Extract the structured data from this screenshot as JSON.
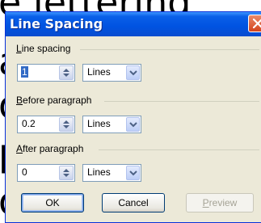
{
  "background_document": {
    "lines": [
      "e lettering",
      "a",
      "o",
      "p",
      "o"
    ]
  },
  "dialog": {
    "title": "Line Spacing",
    "close_icon": "close-icon",
    "line_spacing": {
      "label_mnemonic": "L",
      "label_rest": "ine spacing",
      "value": "1",
      "unit": "Lines"
    },
    "before_paragraph": {
      "label_mnemonic": "B",
      "label_rest": "efore paragraph",
      "value": "0.2",
      "unit": "Lines"
    },
    "after_paragraph": {
      "label_mnemonic": "A",
      "label_rest": "fter paragraph",
      "value": "0",
      "unit": "Lines"
    },
    "buttons": {
      "ok": "OK",
      "cancel": "Cancel",
      "preview_mnemonic": "P",
      "preview_rest": "review"
    }
  },
  "colors": {
    "titlebar": "#0053e1",
    "dialog_bg": "#ece9d8",
    "close_button": "#d4441c",
    "selection": "#316ac5"
  }
}
